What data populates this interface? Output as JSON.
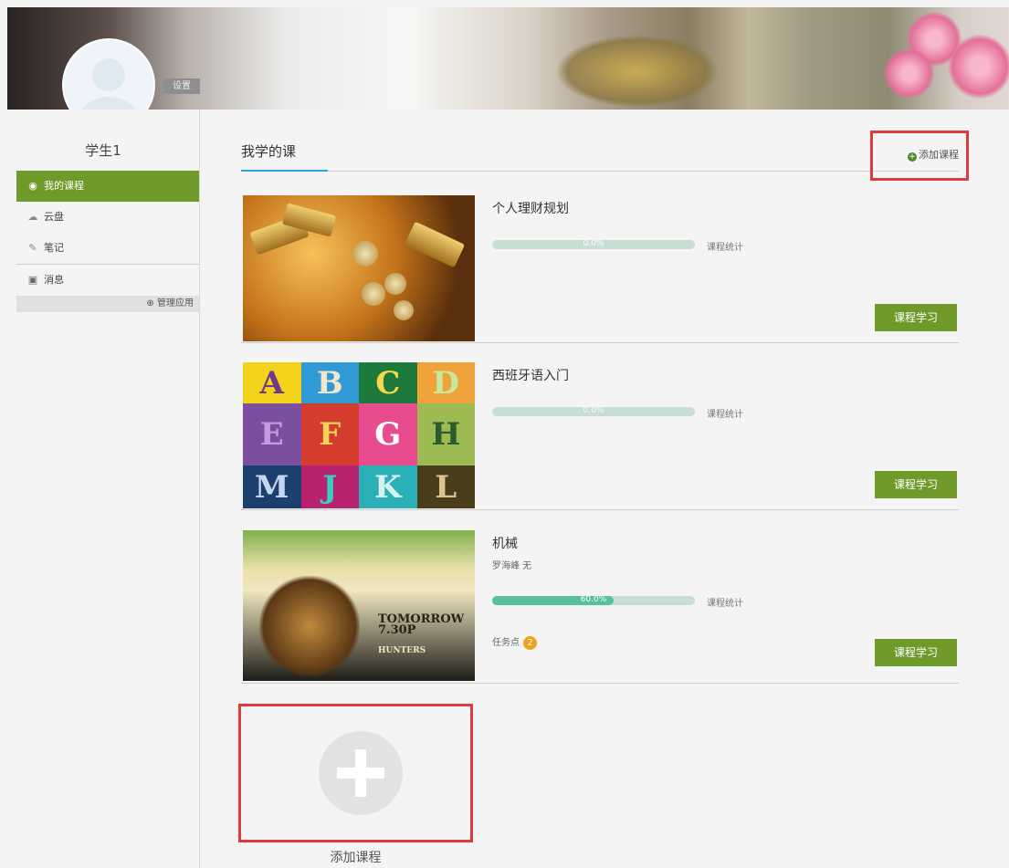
{
  "profile": {
    "setting_label": "设置",
    "username": "学生1"
  },
  "sidebar": {
    "items": [
      {
        "label": "我的课程",
        "icon": "binoculars-icon"
      },
      {
        "label": "云盘",
        "icon": "cloud-icon"
      },
      {
        "label": "笔记",
        "icon": "pen-icon"
      },
      {
        "label": "消息",
        "icon": "message-icon"
      }
    ],
    "manage_label": "管理应用"
  },
  "main": {
    "tab_label": "我学的课",
    "add_course_label": "添加课程"
  },
  "courses": [
    {
      "name": "个人理财规划",
      "teacher": "",
      "progress_text": "0.0%",
      "progress": 0.0,
      "stat_label": "课程统计",
      "study_label": "课程学习"
    },
    {
      "name": "西班牙语入门",
      "teacher": "",
      "progress_text": "0.0%",
      "progress": 0.0,
      "stat_label": "课程统计",
      "study_label": "课程学习"
    },
    {
      "name": "机械",
      "teacher": "罗海峰 无",
      "progress_text": "60.0%",
      "progress": 0.6,
      "stat_label": "课程统计",
      "study_label": "课程学习",
      "task_label": "任务点",
      "task_count": "2"
    }
  ],
  "abc_letters": [
    "A",
    "B",
    "C",
    "D",
    "E",
    "F",
    "G",
    "H",
    "M",
    "J",
    "K",
    "L"
  ],
  "lion_text": [
    "TOMORROW",
    "7.30P",
    "HUNTERS"
  ],
  "add_card_label": "添加课程",
  "colors": {
    "accent_green": "#6f9a2a",
    "progress_fill": "#57c29a",
    "highlight_red": "#e03a3a",
    "tab_underline": "#2aa7d8"
  }
}
